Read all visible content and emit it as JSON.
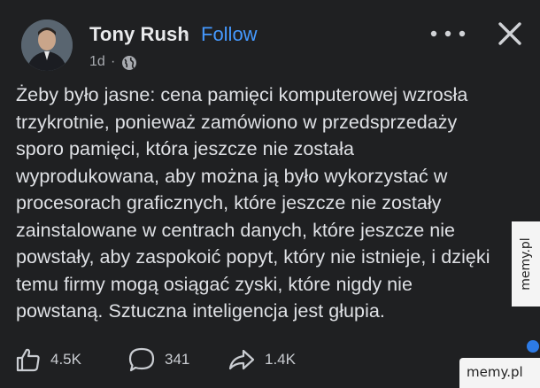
{
  "author": {
    "name": "Tony Rush",
    "separator": "·",
    "follow_label": "Follow",
    "time": "1d",
    "meta_separator": "·",
    "audience_icon": "globe-icon"
  },
  "header_actions": {
    "more_icon": "more-horizontal-icon",
    "close_icon": "close-icon"
  },
  "post": {
    "lines": [
      "Żeby było jasne: cena pamięci komputerowej wzrosła",
      "trzykrotnie, ponieważ zamówiono w przedsprzedaży",
      "sporo pamięci, która jeszcze nie została",
      "wyprodukowana, aby można ją było wykorzystać w",
      "procesorach graficznych, które jeszcze nie zostały",
      "zainstalowane w centrach danych, które jeszcze nie",
      "powstały, aby zaspokoić popyt, który nie istnieje, i dzięki",
      "temu firmy mogą osiągać zyski, które nigdy nie",
      "powstaną. Sztuczna inteligencja jest głupia."
    ]
  },
  "actions": {
    "likes": "4.5K",
    "comments": "341",
    "shares": "1.4K"
  },
  "watermark": {
    "side": "memy.pl",
    "bottom": "memy.pl"
  },
  "colors": {
    "background": "#1f2022",
    "text": "#dfe1e5",
    "link": "#4599ff",
    "muted": "#a8abb0"
  }
}
